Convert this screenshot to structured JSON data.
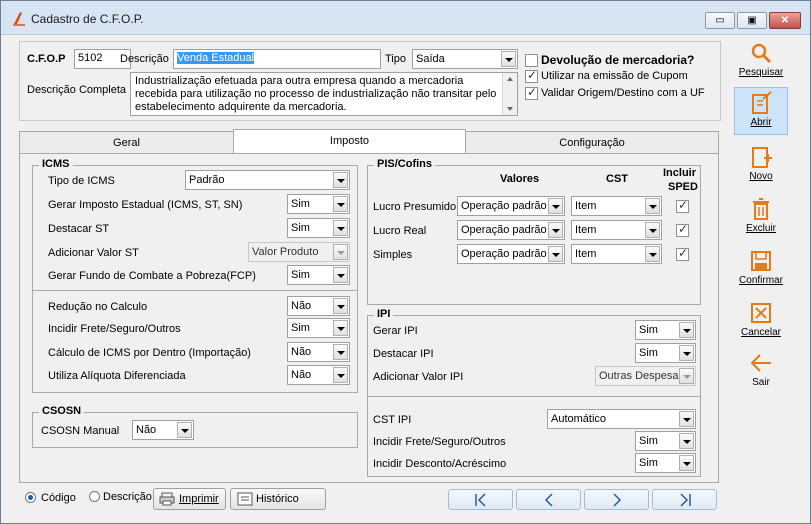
{
  "window": {
    "title": "Cadastro de C.F.O.P.",
    "min": "▭",
    "max": "▣",
    "close": "✕"
  },
  "header": {
    "cfop_label": "C.F.O.P",
    "cfop_value": "5102",
    "descricao_label": "Descrição",
    "descricao_value": "Venda Estadual",
    "tipo_label": "Tipo",
    "tipo_value": "Saída",
    "devolucao_label": "Devolução de mercadoria?",
    "utilizar_label": "Utilizar na emissão de Cupom",
    "validar_label": "Validar Origem/Destino com a UF",
    "desc_completa_label": "Descrição Completa",
    "desc_completa_value": "Industrialização efetuada para outra empresa quando a mercadoria recebida para utilização no processo de industrialização não transitar pelo estabelecimento adquirente da mercadoria."
  },
  "tabs": {
    "geral": "Geral",
    "imposto": "Imposto",
    "configuracao": "Configuração"
  },
  "icms": {
    "title": "ICMS",
    "tipo_label": "Tipo de ICMS",
    "tipo_value": "Padrão",
    "gerar_label": "Gerar Imposto Estadual (ICMS, ST, SN)",
    "gerar_value": "Sim",
    "destacar_label": "Destacar ST",
    "destacar_value": "Sim",
    "adicionar_label": "Adicionar Valor ST",
    "adicionar_value": "Valor Produto",
    "fcp_label": "Gerar Fundo de Combate a Pobreza(FCP)",
    "fcp_value": "Sim",
    "reducao_label": "Redução no Calculo",
    "reducao_value": "Não",
    "incidir_label": "Incidir Frete/Seguro/Outros",
    "incidir_value": "Sim",
    "calculo_label": "Cálculo de ICMS por Dentro  (Importação)",
    "calculo_value": "Não",
    "aliquota_label": "Utiliza Alíquota Diferenciada",
    "aliquota_value": "Não"
  },
  "csosn": {
    "title": "CSOSN",
    "manual_label": "CSOSN Manual",
    "manual_value": "Não"
  },
  "pis": {
    "title": "PIS/Cofins",
    "col_valores": "Valores",
    "col_cst": "CST",
    "col_incluir": "Incluir",
    "col_sped": "SPED",
    "rows": [
      {
        "label": "Lucro Presumido",
        "valor": "Operação padrão",
        "cst": "Item"
      },
      {
        "label": "Lucro Real",
        "valor": "Operação padrão",
        "cst": "Item"
      },
      {
        "label": "Simples",
        "valor": "Operação padrão",
        "cst": "Item"
      }
    ]
  },
  "ipi": {
    "title": "IPI",
    "gerar_label": "Gerar IPI",
    "gerar_value": "Sim",
    "destacar_label": "Destacar IPI",
    "destacar_value": "Sim",
    "adicionar_label": "Adicionar Valor IPI",
    "adicionar_value": "Outras Despesas",
    "cst_label": "CST IPI",
    "cst_value": "Automático",
    "incidir_label": "Incidir Frete/Seguro/Outros",
    "incidir_value": "Sim",
    "desconto_label": "Incidir Desconto/Acréscimo",
    "desconto_value": "Sim"
  },
  "toolbar": {
    "pesquisar": "Pesquisar",
    "abrir": "Abrir",
    "novo": "Novo",
    "excluir": "Excluir",
    "confirmar": "Confirmar",
    "cancelar": "Cancelar",
    "sair": "Sair"
  },
  "footer": {
    "codigo": "Código",
    "descricao": "Descrição",
    "imprimir": "Imprimir",
    "historico": "Histórico"
  },
  "colors": {
    "titlebar": "#d7e5f3",
    "selection": "#3399ff",
    "accent": "#e47b1a",
    "tool_active": "#cde3f7"
  }
}
